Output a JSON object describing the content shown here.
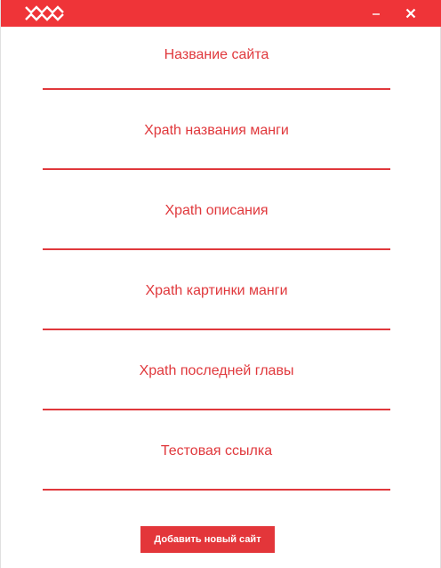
{
  "titlebar": {
    "logo_icon": "manga-logo-icon",
    "minimize_icon": "minimize-icon",
    "close_icon": "close-icon",
    "color": "#ef3438"
  },
  "form": {
    "fields": [
      {
        "label": "Название сайта",
        "value": ""
      },
      {
        "label": "Xpath названия манги",
        "value": ""
      },
      {
        "label": "Xpath описания",
        "value": ""
      },
      {
        "label": "Xpath картинки манги",
        "value": ""
      },
      {
        "label": "Xpath последней главы",
        "value": ""
      },
      {
        "label": "Тестовая ссылка",
        "value": ""
      }
    ],
    "submit_label": "Добавить новый сайт",
    "accent_color": "#e0383c"
  }
}
